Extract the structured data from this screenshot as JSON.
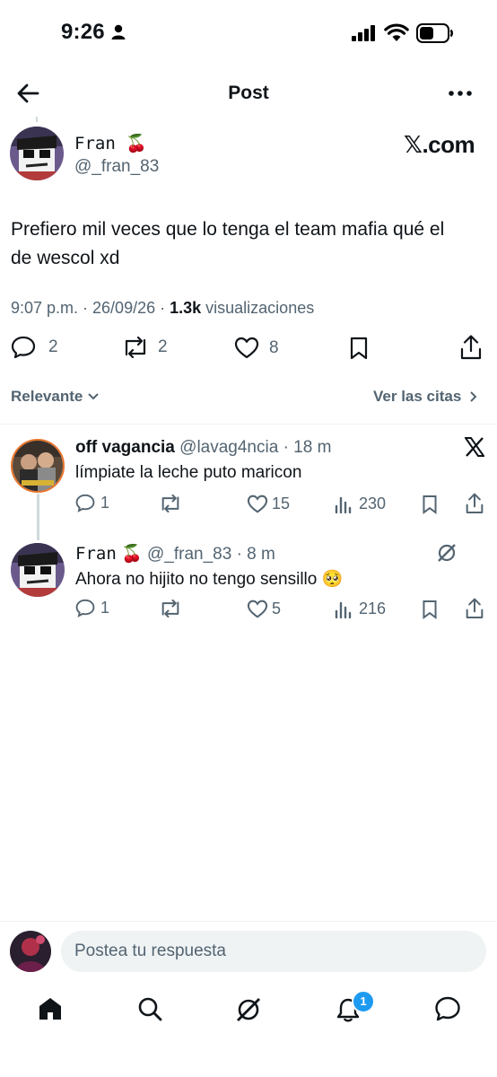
{
  "status_bar": {
    "time": "9:26"
  },
  "header": {
    "title": "Post"
  },
  "post": {
    "author_name": "Fran",
    "author_emoji": "🍒",
    "handle": "@_fran_83",
    "watermark": "𝕏.com",
    "text_line1": "Prefiero mil veces que lo tenga el team mafia qué el",
    "text_line2": "de wescol xd",
    "timestamp": "9:07 p.m. · 26/09/26 · ",
    "views_count": "1.3k",
    "views_label": " visualizaciones",
    "replies": "2",
    "reposts": "2",
    "likes": "8"
  },
  "filters": {
    "sort_label": "Relevante",
    "quotes_label": "Ver las citas"
  },
  "replies": [
    {
      "name": "off vagancia",
      "handle": "@lavag4ncia",
      "time": "· 18 m",
      "text": "límpiate la leche puto maricon",
      "replies": "1",
      "reposts": "",
      "likes": "15",
      "views": "230"
    },
    {
      "name": "Fran",
      "emoji": "🍒",
      "handle": "@_fran_83",
      "time": "· 8 m",
      "text": "Ahora no hijito no tengo sensillo",
      "text_emoji": "🥺",
      "replies": "1",
      "reposts": "",
      "likes": "5",
      "views": "216"
    }
  ],
  "composer": {
    "placeholder": "Postea tu respuesta"
  },
  "bottom_nav": {
    "notifications_badge": "1"
  },
  "colors": {
    "accent": "#1d9bf0",
    "text": "#0f1419",
    "secondary": "#536471",
    "divider": "#eff3f4"
  }
}
